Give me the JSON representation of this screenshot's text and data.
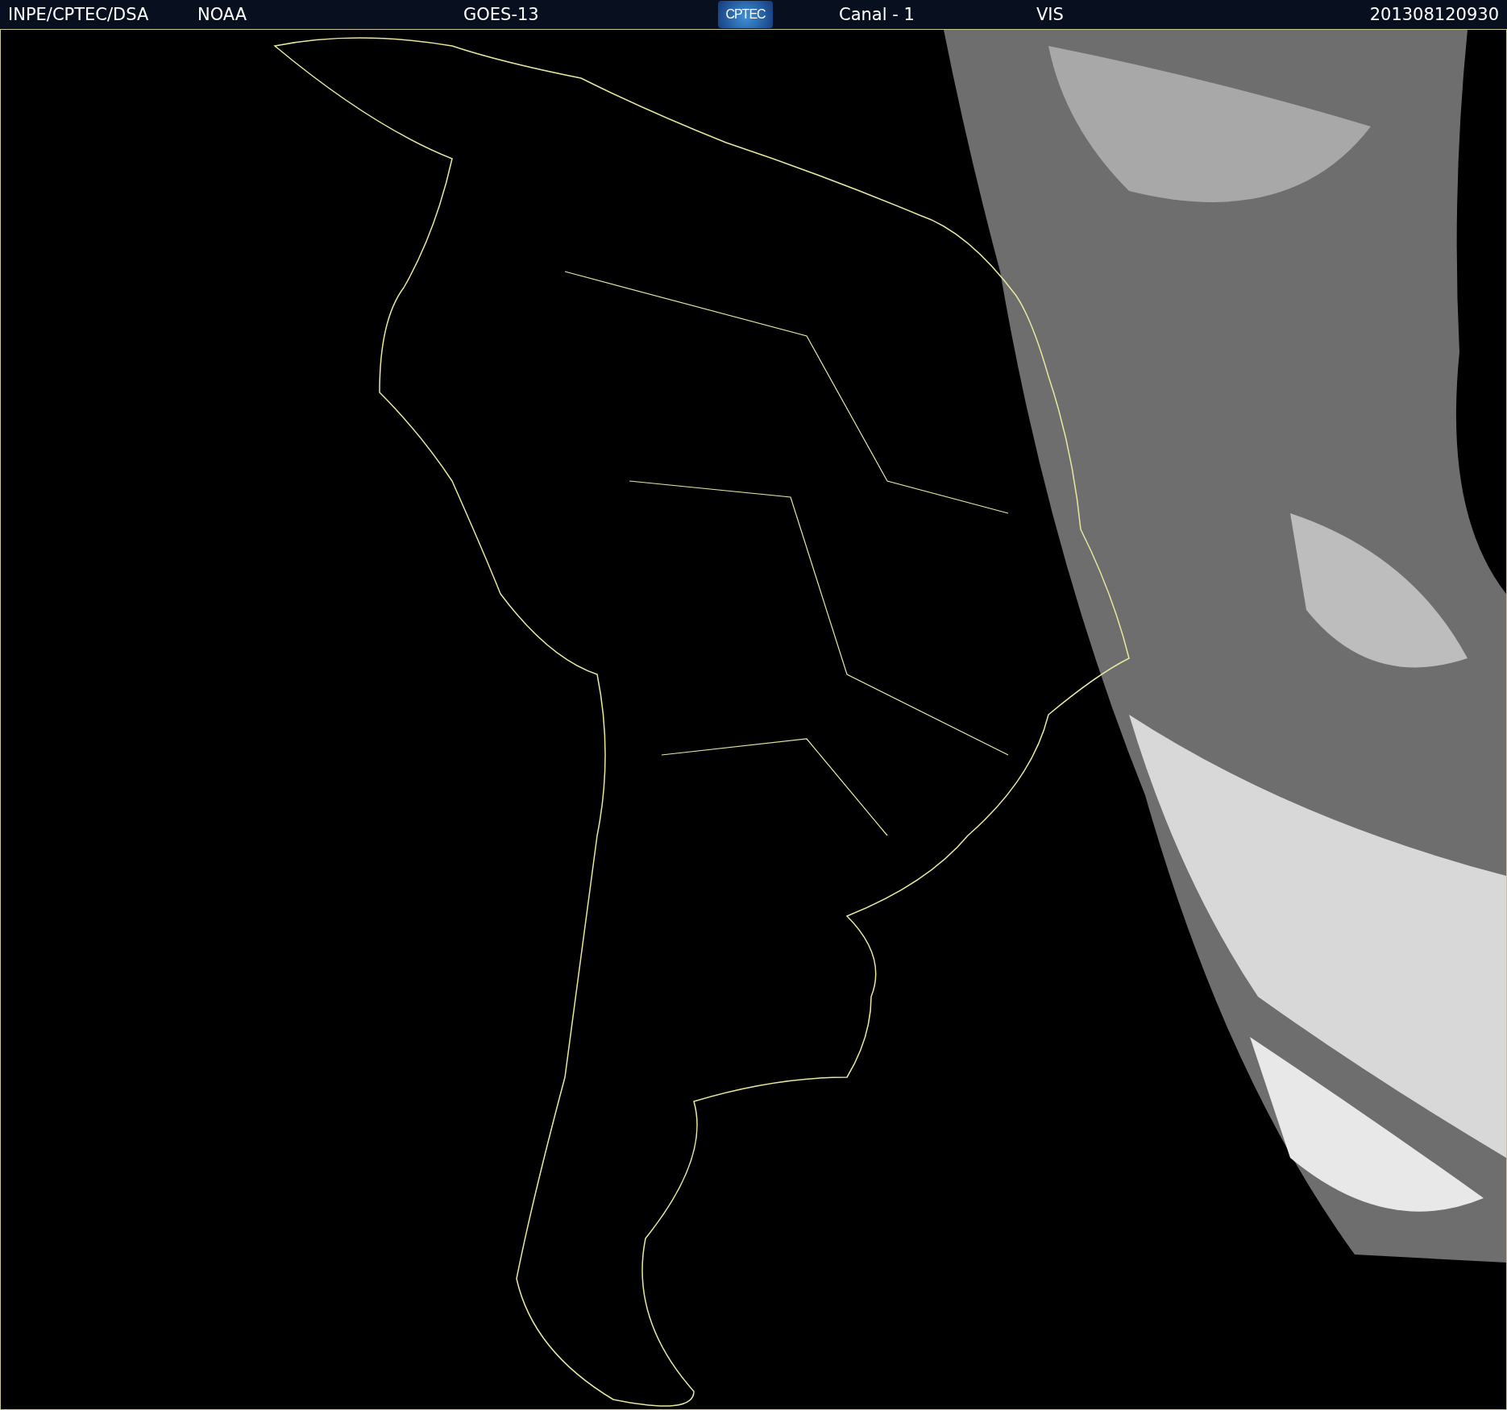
{
  "header": {
    "source": "INPE/CPTEC/DSA",
    "agency": "NOAA",
    "satellite": "GOES-13",
    "logo_text": "CPTEC",
    "channel": "Canal - 1",
    "band": "VIS",
    "timestamp": "201308120930"
  }
}
